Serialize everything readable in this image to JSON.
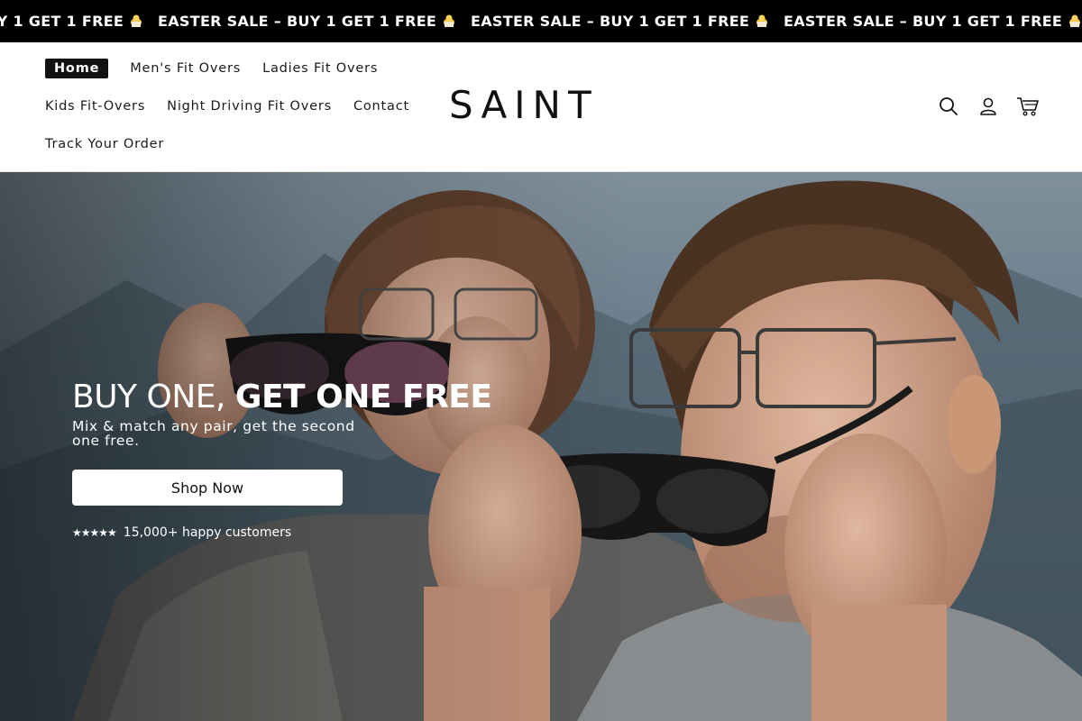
{
  "announcement": {
    "text": "EASTER SALE – BUY 1 GET 1 FREE",
    "emoji_icon": "chick-icon",
    "background": "#000000",
    "color": "#ffffff"
  },
  "header": {
    "logo": "SAINT",
    "nav": [
      {
        "label": "Home",
        "active": true
      },
      {
        "label": "Men's Fit Overs",
        "active": false
      },
      {
        "label": "Ladies Fit Overs",
        "active": false
      },
      {
        "label": "Kids Fit-Overs",
        "active": false
      },
      {
        "label": "Night Driving Fit Overs",
        "active": false
      },
      {
        "label": "Contact",
        "active": false
      },
      {
        "label": "Track Your Order",
        "active": false
      }
    ],
    "icons": [
      "search-icon",
      "account-icon",
      "cart-icon"
    ]
  },
  "hero": {
    "title_light": "BUY ONE, ",
    "title_bold": "GET ONE FREE",
    "subtitle": "Mix & match any pair, get the second one free.",
    "button_label": "Shop Now",
    "rating_stars": "★★★★★",
    "social_proof": "15,000+ happy customers"
  },
  "colors": {
    "primary": "#121212",
    "hero_text": "#ffffff"
  }
}
